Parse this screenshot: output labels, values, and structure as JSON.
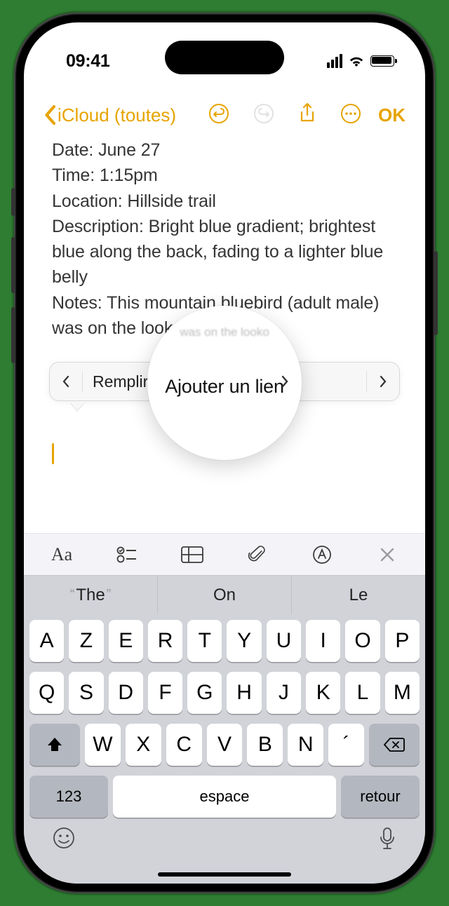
{
  "status": {
    "time": "09:41"
  },
  "nav": {
    "back_label": "iCloud (toutes)",
    "done_label": "OK"
  },
  "note": {
    "line1": "Date: June 27",
    "line2": "Time: 1:15pm",
    "line3": "Location: Hillside trail",
    "line4": "Description: Bright blue gradient; brightest blue along the back, fading to a lighter blue belly",
    "line5": "Notes: This mountain bluebird (adult male) was on the looko"
  },
  "popover": {
    "item1": "Remplir",
    "item2": "Ajouter un lien"
  },
  "magnifier": {
    "faint": "was on the looko",
    "main": "Ajouter un lien"
  },
  "suggestions": {
    "s1": "The",
    "s2": "On",
    "s3": "Le"
  },
  "keyboard": {
    "row1": [
      "A",
      "Z",
      "E",
      "R",
      "T",
      "Y",
      "U",
      "I",
      "O",
      "P"
    ],
    "row2": [
      "Q",
      "S",
      "D",
      "F",
      "G",
      "H",
      "J",
      "K",
      "L",
      "M"
    ],
    "row3": [
      "W",
      "X",
      "C",
      "V",
      "B",
      "N",
      "´"
    ],
    "numbers_label": "123",
    "space_label": "espace",
    "return_label": "retour"
  },
  "icons": {
    "undo": "undo-icon",
    "redo": "redo-icon",
    "share": "share-icon",
    "more": "more-icon",
    "format": "Aa",
    "checklist": "checklist-icon",
    "table": "table-icon",
    "attach": "attach-icon",
    "draw": "draw-icon",
    "close": "close-icon",
    "shift": "shift-icon",
    "delete": "delete-icon",
    "emoji": "emoji-icon",
    "mic": "mic-icon"
  },
  "colors": {
    "accent": "#e7a400",
    "kbd_bg": "#d1d3d9",
    "key_bg": "#ffffff",
    "fn_key_bg": "#b3b7bf"
  }
}
